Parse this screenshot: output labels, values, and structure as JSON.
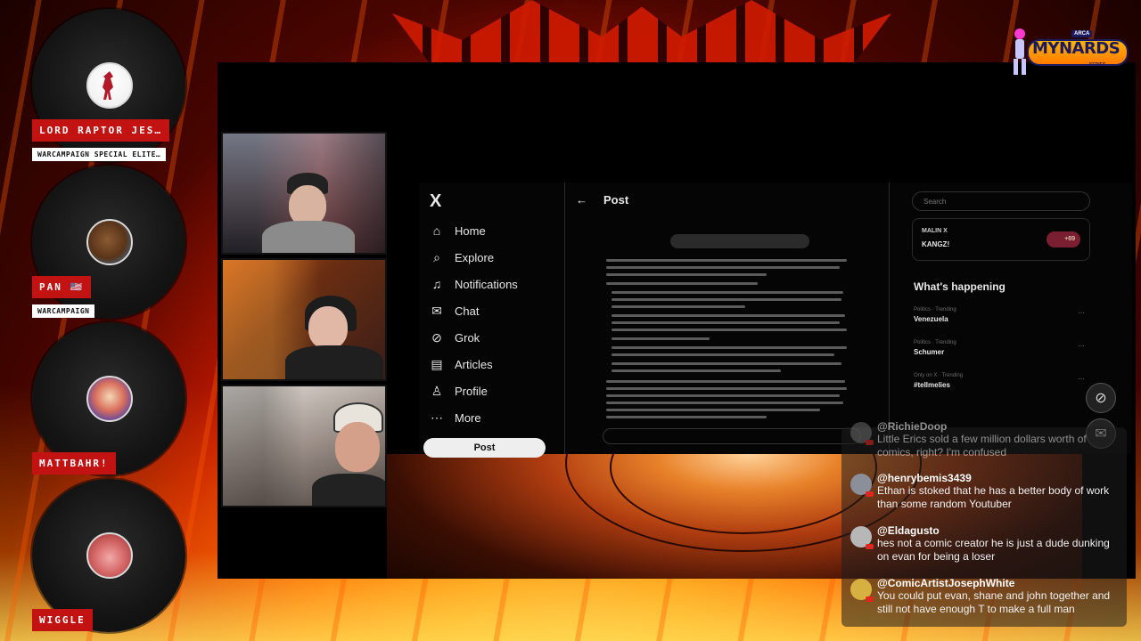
{
  "colors": {
    "name_tag": "#c21212",
    "x_background": "#050505",
    "x_text": "#e7e7e7",
    "chat_panel": "rgba(30,30,30,.55)"
  },
  "logo": {
    "prefix": "ARCA",
    "name": "MYNARDS",
    "suffix": "SERIES"
  },
  "participants": [
    {
      "name": "LORD RAPTOR JES…",
      "subtitle": "WARCAMPAIGN SPECIAL ELITE…",
      "avatar_icon": "skeleton-figure-icon"
    },
    {
      "name": "PAN 🇺🇸",
      "subtitle": "WARCAMPAIGN",
      "avatar_icon": "bigfoot-icon"
    },
    {
      "name": "MATTBAHR!",
      "subtitle": "",
      "avatar_icon": "comic-art-icon"
    },
    {
      "name": "WIGGLE",
      "subtitle": "",
      "avatar_icon": "monkey-icon"
    }
  ],
  "x_app": {
    "logo": "X",
    "nav": [
      {
        "label": "Home",
        "icon": "home-icon"
      },
      {
        "label": "Explore",
        "icon": "search-icon"
      },
      {
        "label": "Notifications",
        "icon": "bell-icon"
      },
      {
        "label": "Chat",
        "icon": "mail-icon"
      },
      {
        "label": "Grok",
        "icon": "grok-icon"
      },
      {
        "label": "Articles",
        "icon": "articles-icon"
      },
      {
        "label": "Profile",
        "icon": "person-icon"
      },
      {
        "label": "More",
        "icon": "more-icon"
      }
    ],
    "post_button": "Post",
    "post_header": "Post",
    "search_placeholder": "Search",
    "pinned": {
      "user": "MALIN X",
      "text": "KANGZ!",
      "count": "+69"
    },
    "happening_title": "What's happening",
    "trends": [
      {
        "meta": "Politics · Trending",
        "label": "Venezuela"
      },
      {
        "meta": "Politics · Trending",
        "label": "Schumer"
      },
      {
        "meta": "Only on X · Trending",
        "label": "#tellmelies"
      }
    ]
  },
  "chat": {
    "messages": [
      {
        "user": "@RichieDoop",
        "text": "Little Erics sold a few million dollars worth of comics, right? I'm confused",
        "avatar_color": "#6a6a6a"
      },
      {
        "user": "@henrybemis3439",
        "text": "Ethan is stoked that he has a better body of work than some random Youtuber",
        "avatar_color": "#8a8f99"
      },
      {
        "user": "@Eldagusto",
        "text": "hes not a comic creator he is just a dude dunking on evan for being a loser",
        "avatar_color": "#b7b7b7"
      },
      {
        "user": "@ComicArtistJosephWhite",
        "text": "You could put evan, shane and john together and still not have enough T to make a full man",
        "avatar_color": "#d6b040"
      }
    ]
  }
}
